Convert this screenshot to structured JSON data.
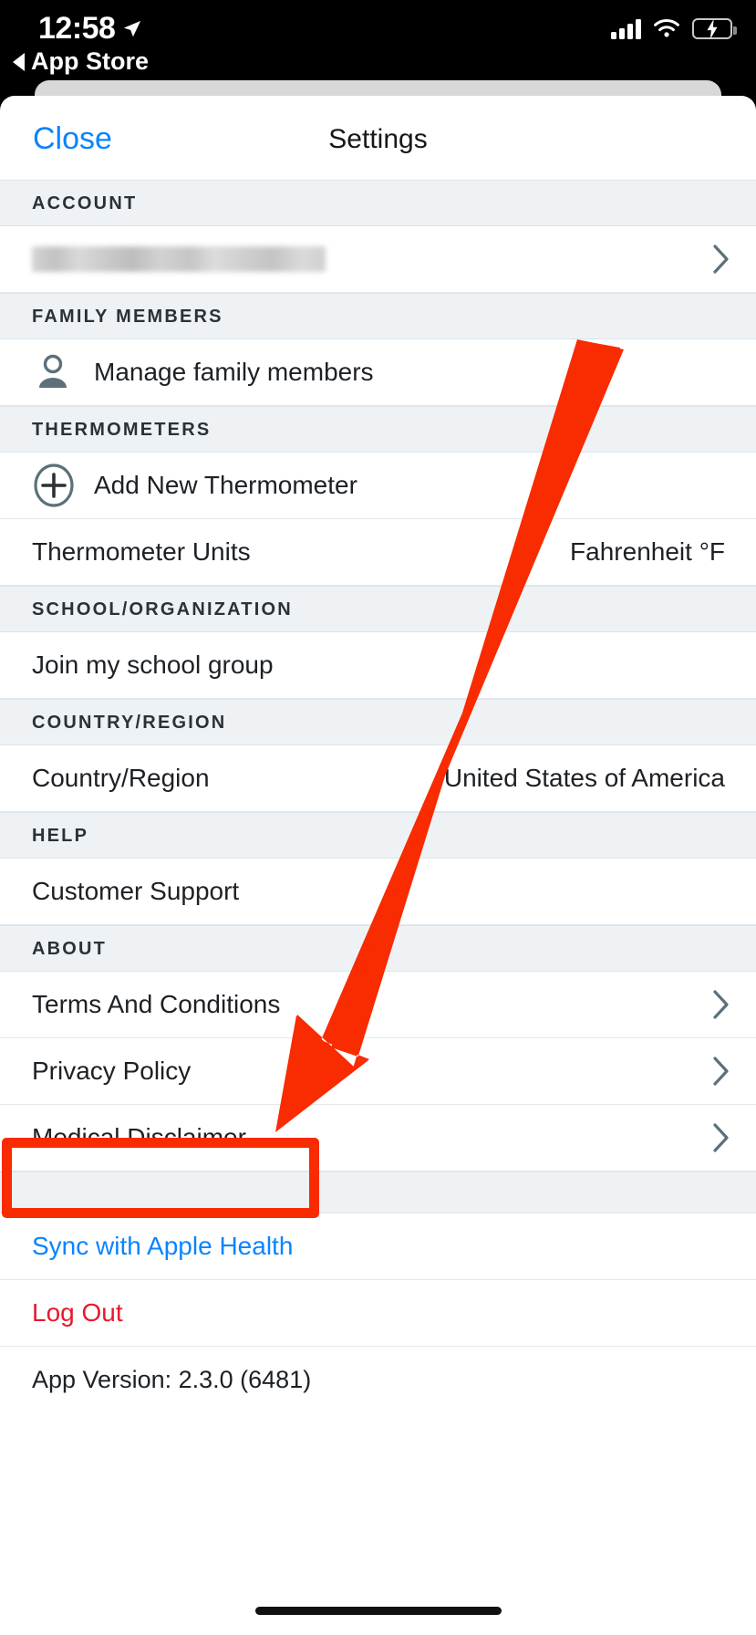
{
  "status_bar": {
    "time": "12:58",
    "location_icon": "location-arrow-icon",
    "signal_icon": "cellular-signal-icon",
    "wifi_icon": "wifi-icon",
    "battery_icon": "battery-charging-icon",
    "battery_state": "charging",
    "battery_color": "#2fd158"
  },
  "back_link": {
    "label": "App Store",
    "icon": "back-triangle-icon"
  },
  "navbar": {
    "close_label": "Close",
    "title": "Settings",
    "close_color": "#0a84ff"
  },
  "sections": [
    {
      "header": "ACCOUNT",
      "rows": [
        {
          "name": "account-row",
          "label": "",
          "redacted": true,
          "chevron": true
        }
      ]
    },
    {
      "header": "FAMILY MEMBERS",
      "rows": [
        {
          "name": "manage-family-members-row",
          "label": "Manage family members",
          "icon": "person-icon"
        }
      ]
    },
    {
      "header": "THERMOMETERS",
      "rows": [
        {
          "name": "add-new-thermometer-row",
          "label": "Add New Thermometer",
          "icon": "plus-circle-icon"
        },
        {
          "name": "thermometer-units-row",
          "label": "Thermometer Units",
          "value": "Fahrenheit °F"
        }
      ]
    },
    {
      "header": "SCHOOL/ORGANIZATION",
      "rows": [
        {
          "name": "join-school-group-row",
          "label": "Join my school group"
        }
      ]
    },
    {
      "header": "COUNTRY/REGION",
      "rows": [
        {
          "name": "country-region-row",
          "label": "Country/Region",
          "value": "United States of America"
        }
      ]
    },
    {
      "header": "HELP",
      "rows": [
        {
          "name": "customer-support-row",
          "label": "Customer Support"
        }
      ]
    },
    {
      "header": "ABOUT",
      "rows": [
        {
          "name": "terms-and-conditions-row",
          "label": "Terms And Conditions",
          "chevron": true
        },
        {
          "name": "privacy-policy-row",
          "label": "Privacy Policy",
          "chevron": true
        },
        {
          "name": "medical-disclaimer-row",
          "label": "Medical Disclaimer",
          "chevron": true
        }
      ]
    }
  ],
  "footer": {
    "sync_label": "Sync with Apple Health",
    "sync_color": "#0a84ff",
    "logout_label": "Log Out",
    "logout_color": "#e8192c",
    "app_version": "App Version: 2.3.0 (6481)"
  },
  "annotation": {
    "highlight_target": "Sync with Apple Health",
    "highlight_color": "#f92b00",
    "arrow_color": "#f92b00"
  }
}
